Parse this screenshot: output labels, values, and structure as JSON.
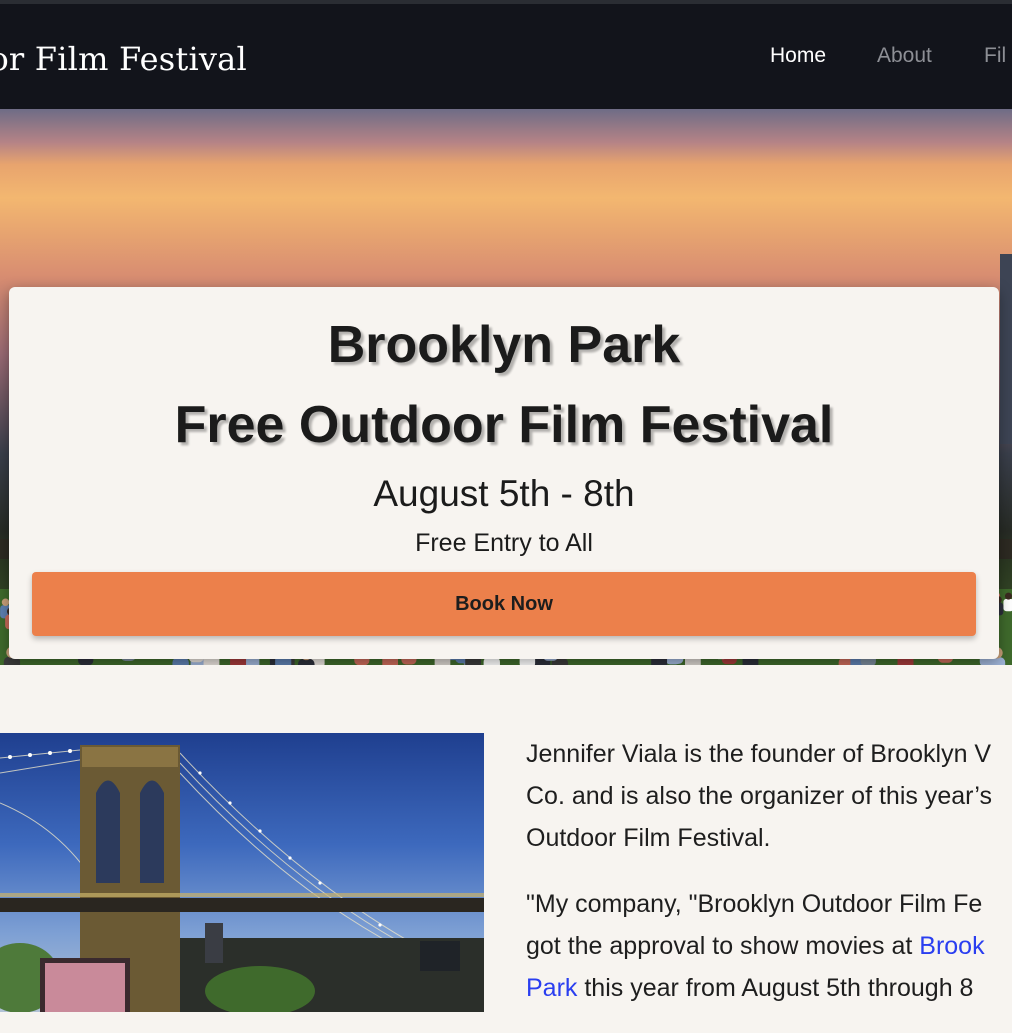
{
  "nav": {
    "brand": "oor Film Festival",
    "links": [
      {
        "label": "Home",
        "active": true
      },
      {
        "label": "About",
        "active": false
      },
      {
        "label": "Fil",
        "active": false
      }
    ]
  },
  "hero": {
    "title_line1": "Brooklyn Park",
    "title_line2": "Free Outdoor Film Festival",
    "dates": "August 5th - 8th",
    "entry": "Free Entry to All",
    "button_label": "Book Now",
    "button_color": "#ec804b"
  },
  "article": {
    "lines": [
      "Jennifer Viala is the founder of Brooklyn V",
      "Co. and is also the organizer of this year’s",
      "Outdoor Film Festival."
    ],
    "quote_lines": [
      "\"My company, \"Brooklyn Outdoor Film Fe",
      "got the approval to show movies at "
    ],
    "link_part1": "Brook",
    "link_part2": "Park",
    "quote_tail": " this year from August 5th through 8",
    "link_color": "#2a3ef0"
  }
}
